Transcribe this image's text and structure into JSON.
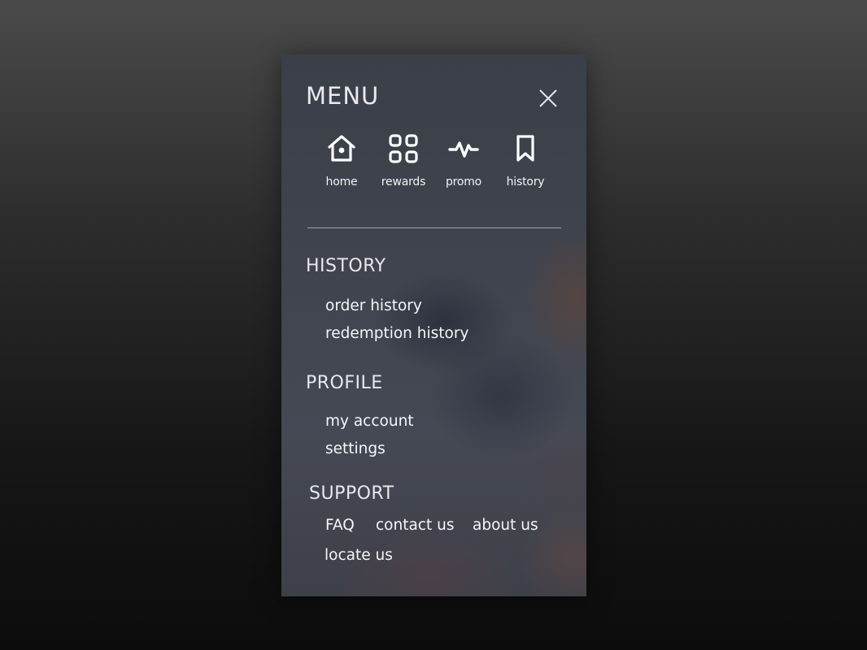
{
  "menu": {
    "title": "MENU",
    "close_icon": "close-icon"
  },
  "quick_nav": [
    {
      "label": "home",
      "icon": "home-icon"
    },
    {
      "label": "rewards",
      "icon": "grid-icon"
    },
    {
      "label": "promo",
      "icon": "pulse-icon"
    },
    {
      "label": "history",
      "icon": "bookmark-icon"
    }
  ],
  "sections": {
    "history": {
      "title": "HISTORY",
      "links": [
        "order history",
        "redemption history"
      ]
    },
    "profile": {
      "title": "PROFILE",
      "links": [
        "my account",
        "settings"
      ]
    },
    "support": {
      "title": "SUPPORT",
      "links": [
        "FAQ",
        "contact us",
        "about us",
        "locate us"
      ]
    }
  },
  "colors": {
    "text": "#f6f6f8",
    "panel": "#3a3f4a",
    "divider": "#9a9ca3"
  }
}
